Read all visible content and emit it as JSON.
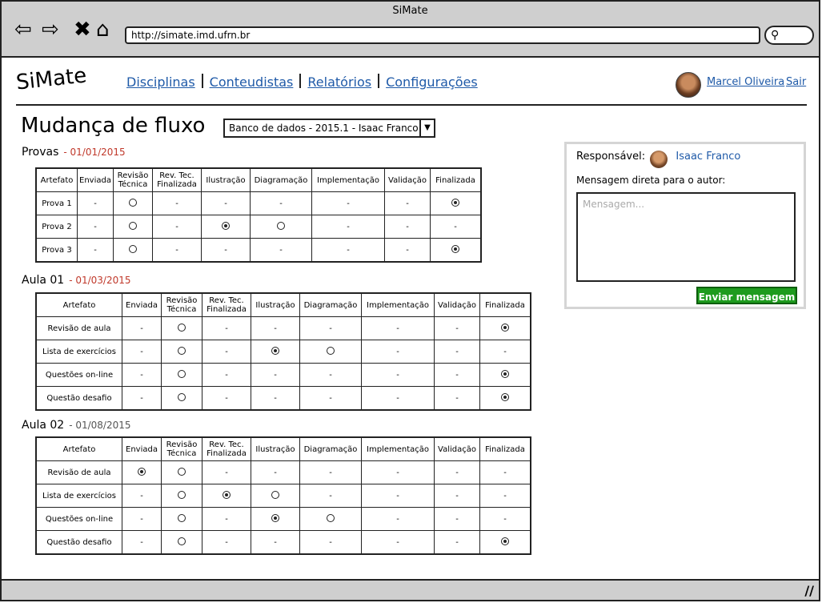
{
  "window": {
    "title": "SiMate"
  },
  "browser": {
    "url": "http://simate.imd.ufrn.br"
  },
  "logo": "SiMate",
  "menu": {
    "items": [
      "Disciplinas",
      "Conteudistas",
      "Relatórios",
      "Configurações"
    ]
  },
  "user": {
    "name": "Marcel Oliveira",
    "logout": "Sair"
  },
  "page": {
    "title": "Mudança de fluxo",
    "selected_course": "Banco de dados - 2015.1 - Isaac Franco"
  },
  "columns": [
    "Artefato",
    "Enviada",
    "Revisão Técnica",
    "Rev. Tec. Finalizada",
    "Ilustração",
    "Diagramação",
    "Implementação",
    "Validação",
    "Finalizada"
  ],
  "sections": [
    {
      "name": "Provas",
      "date": "- 01/01/2015",
      "date_color": "#c0392b",
      "rows": [
        {
          "artifact": "Prova 1",
          "cells": [
            "-",
            "o",
            "-",
            "-",
            "-",
            "-",
            "-",
            "x"
          ]
        },
        {
          "artifact": "Prova 2",
          "cells": [
            "-",
            "o",
            "-",
            "x",
            "o",
            "-",
            "-",
            "-"
          ]
        },
        {
          "artifact": "Prova 3",
          "cells": [
            "-",
            "o",
            "-",
            "-",
            "-",
            "-",
            "-",
            "x"
          ]
        }
      ]
    },
    {
      "name": "Aula 01",
      "date": "- 01/03/2015",
      "date_color": "#c0392b",
      "rows": [
        {
          "artifact": "Revisão de aula",
          "cells": [
            "-",
            "o",
            "-",
            "-",
            "-",
            "-",
            "-",
            "x"
          ]
        },
        {
          "artifact": "Lista de exercícios",
          "cells": [
            "-",
            "o",
            "-",
            "x",
            "o",
            "-",
            "-",
            "-"
          ]
        },
        {
          "artifact": "Questões on-line",
          "cells": [
            "-",
            "o",
            "-",
            "-",
            "-",
            "-",
            "-",
            "x"
          ]
        },
        {
          "artifact": "Questão desafio",
          "cells": [
            "-",
            "o",
            "-",
            "-",
            "-",
            "-",
            "-",
            "x"
          ]
        }
      ]
    },
    {
      "name": "Aula 02",
      "date": "- 01/08/2015",
      "date_color": "#555555",
      "rows": [
        {
          "artifact": "Revisão de aula",
          "cells": [
            "x",
            "o",
            "-",
            "-",
            "-",
            "-",
            "-",
            "-"
          ]
        },
        {
          "artifact": "Lista de exercícios",
          "cells": [
            "-",
            "o",
            "x",
            "o",
            "-",
            "-",
            "-",
            "-"
          ]
        },
        {
          "artifact": "Questões on-line",
          "cells": [
            "-",
            "o",
            "-",
            "x",
            "o",
            "-",
            "-",
            "-"
          ]
        },
        {
          "artifact": "Questão desafio",
          "cells": [
            "-",
            "o",
            "-",
            "-",
            "-",
            "-",
            "-",
            "x"
          ]
        }
      ]
    }
  ],
  "panel": {
    "responsible_label": "Responsável:",
    "responsible_name": "Isaac Franco",
    "message_label": "Mensagem direta para o autor:",
    "message_placeholder": "Mensagem...",
    "send_label": "Enviar mensagem"
  }
}
